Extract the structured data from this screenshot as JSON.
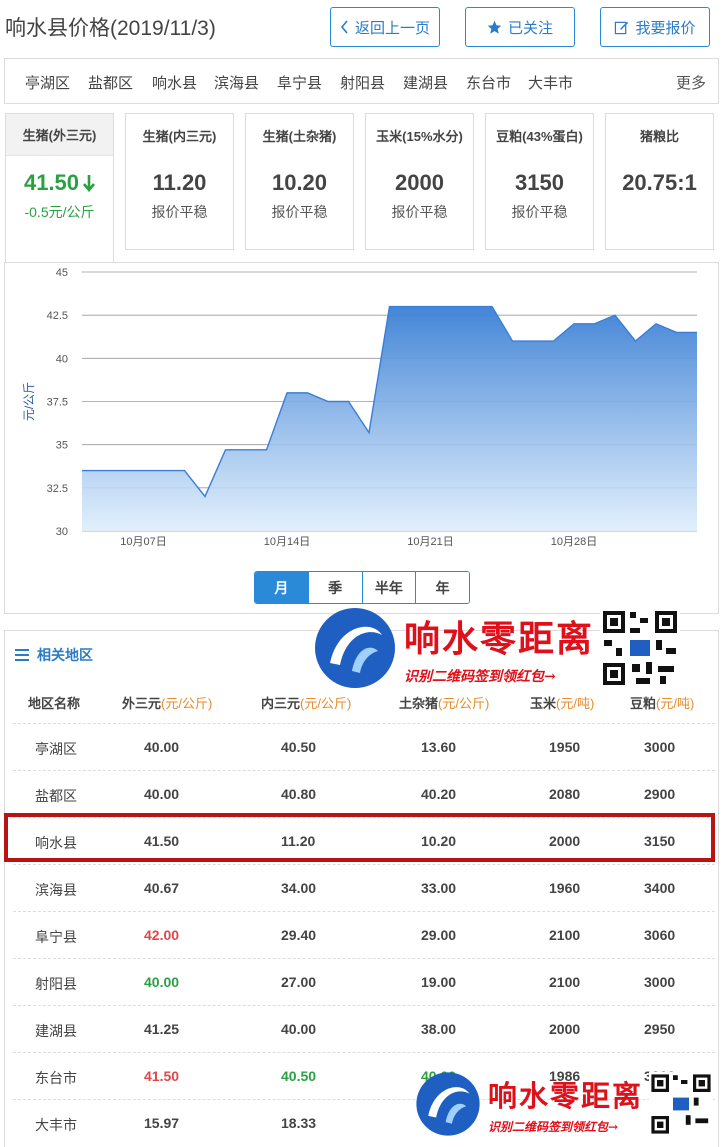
{
  "header": {
    "title": "响水县价格(2019/11/3)",
    "back_label": "返回上一页",
    "follow_label": "已关注",
    "quote_label": "我要报价"
  },
  "regions": {
    "items": [
      "亭湖区",
      "盐都区",
      "响水县",
      "滨海县",
      "阜宁县",
      "射阳县",
      "建湖县",
      "东台市",
      "大丰市"
    ],
    "more": "更多"
  },
  "cards": [
    {
      "label": "生猪(外三元)",
      "value": "41.50",
      "sub": "-0.5元/公斤",
      "trend": "down"
    },
    {
      "label": "生猪(内三元)",
      "value": "11.20",
      "sub": "报价平稳"
    },
    {
      "label": "生猪(土杂猪)",
      "value": "10.20",
      "sub": "报价平稳"
    },
    {
      "label": "玉米(15%水分)",
      "value": "2000",
      "sub": "报价平稳"
    },
    {
      "label": "豆粕(43%蛋白)",
      "value": "3150",
      "sub": "报价平稳"
    },
    {
      "label": "猪粮比",
      "value": "20.75:1",
      "sub": ""
    }
  ],
  "chart_data": {
    "type": "area",
    "ylabel": "元/公斤",
    "ylim": [
      30,
      45
    ],
    "yticks": [
      "45",
      "42.5",
      "40",
      "37.5",
      "35",
      "32.5",
      "30"
    ],
    "xticks": [
      "10月07日",
      "10月14日",
      "10月21日",
      "10月28日"
    ],
    "x": [
      "10-04",
      "10-05",
      "10-06",
      "10-07",
      "10-08",
      "10-09",
      "10-10",
      "10-11",
      "10-12",
      "10-13",
      "10-14",
      "10-15",
      "10-16",
      "10-17",
      "10-18",
      "10-19",
      "10-20",
      "10-21",
      "10-22",
      "10-23",
      "10-24",
      "10-25",
      "10-26",
      "10-27",
      "10-28",
      "10-29",
      "10-30",
      "10-31",
      "11-01",
      "11-02",
      "11-03"
    ],
    "values": [
      33.5,
      33.5,
      33.5,
      33.5,
      33.5,
      33.5,
      32.0,
      34.7,
      34.7,
      34.7,
      38.0,
      38.0,
      37.5,
      37.5,
      35.7,
      43.0,
      43.0,
      43.0,
      43.0,
      43.0,
      43.0,
      41.0,
      41.0,
      41.0,
      42.0,
      42.0,
      42.5,
      41.0,
      42.0,
      41.5,
      41.5
    ],
    "color": "#3a7fd5"
  },
  "timeframes": {
    "items": [
      "月",
      "季",
      "半年",
      "年"
    ],
    "active": 0
  },
  "related": {
    "title": "相关地区",
    "columns": [
      {
        "label": "地区名称",
        "unit": ""
      },
      {
        "label": "外三元",
        "unit": "(元/公斤)"
      },
      {
        "label": "内三元",
        "unit": "(元/公斤)"
      },
      {
        "label": "土杂猪",
        "unit": "(元/公斤)"
      },
      {
        "label": "玉米",
        "unit": "(元/吨)"
      },
      {
        "label": "豆粕",
        "unit": "(元/吨)"
      }
    ],
    "rows": [
      {
        "name": "亭湖区",
        "a": "40.00",
        "b": "40.50",
        "c": "13.60",
        "d": "1950",
        "e": "3000"
      },
      {
        "name": "盐都区",
        "a": "40.00",
        "b": "40.80",
        "c": "40.20",
        "d": "2080",
        "e": "2900"
      },
      {
        "name": "响水县",
        "a": "41.50",
        "b": "11.20",
        "c": "10.20",
        "d": "2000",
        "e": "3150"
      },
      {
        "name": "滨海县",
        "a": "40.67",
        "b": "34.00",
        "c": "33.00",
        "d": "1960",
        "e": "3400"
      },
      {
        "name": "阜宁县",
        "a": "42.00",
        "b": "29.40",
        "c": "29.00",
        "d": "2100",
        "e": "3060",
        "a_color": "red"
      },
      {
        "name": "射阳县",
        "a": "40.00",
        "b": "27.00",
        "c": "19.00",
        "d": "2100",
        "e": "3000",
        "a_color": "green"
      },
      {
        "name": "建湖县",
        "a": "41.25",
        "b": "40.00",
        "c": "38.00",
        "d": "2000",
        "e": "2950"
      },
      {
        "name": "东台市",
        "a": "41.50",
        "b": "40.50",
        "c": "40.00",
        "d": "1986",
        "e": "3000",
        "a_color": "red",
        "b_color": "green",
        "c_color": "green"
      },
      {
        "name": "大丰市",
        "a": "15.97",
        "b": "18.33",
        "c": "",
        "d": "",
        "e": ""
      }
    ]
  },
  "watermark": {
    "title": "响水零距离",
    "subtitle": "识别二维码签到领红包→"
  },
  "colors": {
    "accent": "#2a8ad8",
    "up": "#e04848",
    "down": "#2aa043",
    "highlight": "#b81414"
  }
}
